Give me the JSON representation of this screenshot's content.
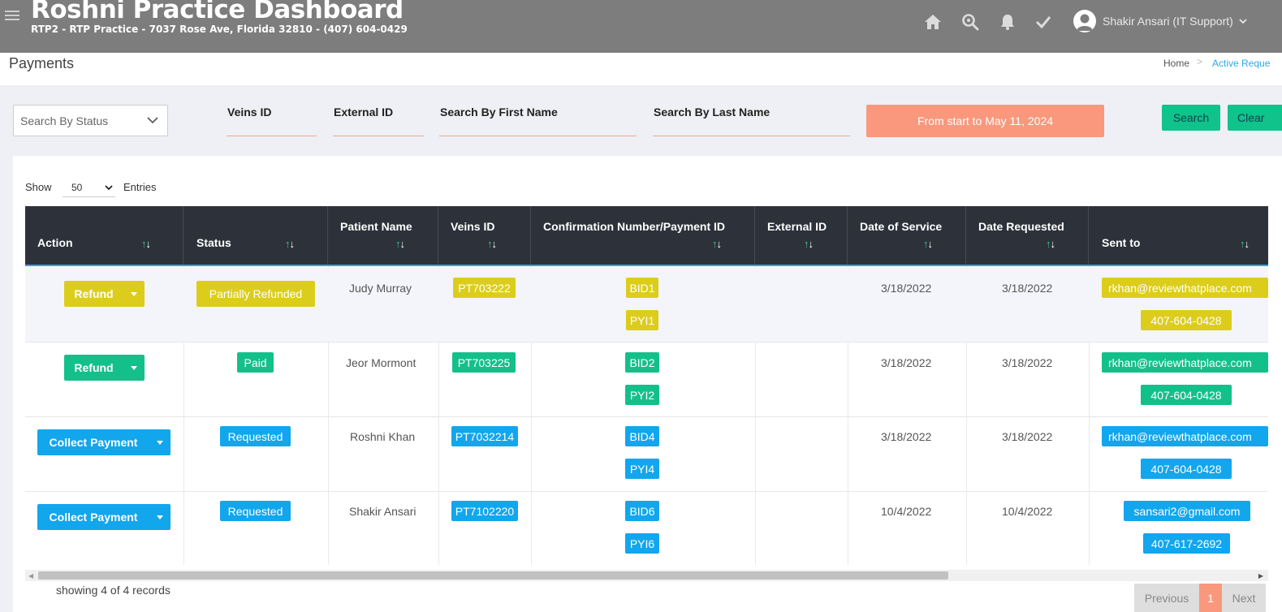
{
  "header": {
    "title": "Roshni Practice Dashboard",
    "subtitle": "RTP2 - RTP Practice - 7037 Rose Ave, Florida 32810 - (407) 604-0429",
    "icons": [
      "menu-icon",
      "home-icon",
      "search-icon",
      "bell-icon",
      "check-icon"
    ],
    "user_name": "Shakir Ansari (IT Support)"
  },
  "page": {
    "title": "Payments",
    "breadcrumb_home": "Home",
    "breadcrumb_active": "Active Reque"
  },
  "filters": {
    "status_placeholder": "Search By Status",
    "veins_id_label": "Veins ID",
    "external_id_label": "External ID",
    "first_name_label": "Search By First Name",
    "last_name_label": "Search By Last Name",
    "date_range": "From start to May 11, 2024",
    "search_button": "Search",
    "clear_button": "Clear"
  },
  "table_controls": {
    "show_label": "Show",
    "page_size": "50",
    "entries_label": "Entries"
  },
  "columns": {
    "action": "Action",
    "status": "Status",
    "patient_name_1": "Patient Name",
    "veins_id": "Veins ID",
    "confirmation": "Confirmation Number/Payment ID",
    "external_id": "External ID",
    "date_of_service": "Date of Service",
    "date_requested": "Date Requested",
    "sent_to": "Sent to",
    "sort_glyph": "↑↓"
  },
  "rows": [
    {
      "action": "Refund",
      "action_color": "#dccd1c",
      "status": "Partially Refunded",
      "patient": "Judy Murray",
      "veins_id": "PT703222",
      "bid": "BID1",
      "pyi": "PYI1",
      "external_id": "",
      "date_of_service": "3/18/2022",
      "date_requested": "3/18/2022",
      "email": "rkhan@reviewthatplace.com",
      "phone": "407-604-0428"
    },
    {
      "action": "Refund",
      "action_color": "#14c08a",
      "status": "Paid",
      "patient": "Jeor Mormont",
      "veins_id": "PT703225",
      "bid": "BID2",
      "pyi": "PYI2",
      "external_id": "",
      "date_of_service": "3/18/2022",
      "date_requested": "3/18/2022",
      "email": "rkhan@reviewthatplace.com",
      "phone": "407-604-0428"
    },
    {
      "action": "Collect Payment",
      "action_color": "#12a6ed",
      "status": "Requested",
      "patient": "Roshni Khan",
      "veins_id": "PT7032214",
      "bid": "BID4",
      "pyi": "PYI4",
      "external_id": "",
      "date_of_service": "3/18/2022",
      "date_requested": "3/18/2022",
      "email": "rkhan@reviewthatplace.com",
      "phone": "407-604-0428"
    },
    {
      "action": "Collect Payment",
      "action_color": "#12a6ed",
      "status": "Requested",
      "patient": "Shakir Ansari",
      "veins_id": "PT7102220",
      "bid": "BID6",
      "pyi": "PYI6",
      "external_id": "",
      "date_of_service": "10/4/2022",
      "date_requested": "10/4/2022",
      "email": "sansari2@gmail.com",
      "phone": "407-617-2692"
    }
  ],
  "footer": {
    "records": "showing 4 of 4 records",
    "previous": "Previous",
    "current_page": "1",
    "next": "Next"
  },
  "colors": {
    "header_bg": "#7d7d7d",
    "accent_orange": "#f9987d",
    "green": "#14c08a",
    "blue": "#12a6ed",
    "yellow": "#dccd1c"
  }
}
